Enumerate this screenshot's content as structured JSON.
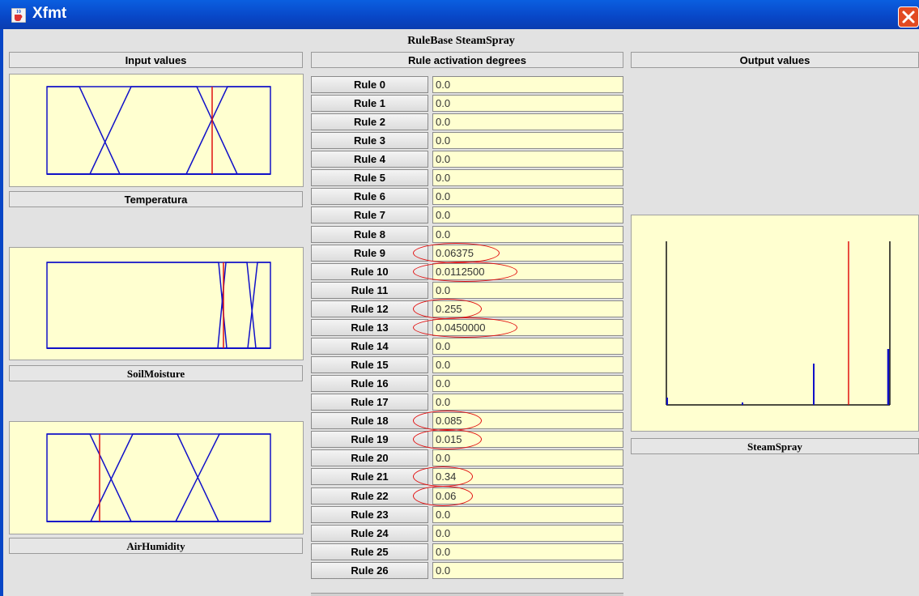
{
  "window": {
    "title": "Xfmt",
    "app_icon": "java-cup-icon",
    "close_icon": "close-x-icon"
  },
  "rulebase_title": "RuleBase SteamSpray",
  "panels": {
    "input_header": "Input values",
    "rules_header": "Rule activation degrees",
    "output_header": "Output values"
  },
  "inputs": [
    {
      "name": "Temperatura",
      "crisp_fraction": 0.74
    },
    {
      "name": "SoilMoisture",
      "crisp_fraction": 0.79
    },
    {
      "name": "AirHumidity",
      "crisp_fraction": 0.24
    }
  ],
  "output": {
    "name": "SteamSpray",
    "crisp_fraction": 0.81
  },
  "rules": [
    {
      "label": "Rule 0",
      "value": "0.0",
      "highlighted": false
    },
    {
      "label": "Rule 1",
      "value": "0.0",
      "highlighted": false
    },
    {
      "label": "Rule 2",
      "value": "0.0",
      "highlighted": false
    },
    {
      "label": "Rule 3",
      "value": "0.0",
      "highlighted": false
    },
    {
      "label": "Rule 4",
      "value": "0.0",
      "highlighted": false
    },
    {
      "label": "Rule 5",
      "value": "0.0",
      "highlighted": false
    },
    {
      "label": "Rule 6",
      "value": "0.0",
      "highlighted": false
    },
    {
      "label": "Rule 7",
      "value": "0.0",
      "highlighted": false
    },
    {
      "label": "Rule 8",
      "value": "0.0",
      "highlighted": false
    },
    {
      "label": "Rule 9",
      "value": "0.06375",
      "highlighted": true
    },
    {
      "label": "Rule 10",
      "value": "0.0112500",
      "highlighted": true
    },
    {
      "label": "Rule 11",
      "value": "0.0",
      "highlighted": false
    },
    {
      "label": "Rule 12",
      "value": "0.255",
      "highlighted": true
    },
    {
      "label": "Rule 13",
      "value": "0.0450000",
      "highlighted": true
    },
    {
      "label": "Rule 14",
      "value": "0.0",
      "highlighted": false
    },
    {
      "label": "Rule 15",
      "value": "0.0",
      "highlighted": false
    },
    {
      "label": "Rule 16",
      "value": "0.0",
      "highlighted": false
    },
    {
      "label": "Rule 17",
      "value": "0.0",
      "highlighted": false
    },
    {
      "label": "Rule 18",
      "value": "0.085",
      "highlighted": true
    },
    {
      "label": "Rule 19",
      "value": "0.015",
      "highlighted": true
    },
    {
      "label": "Rule 20",
      "value": "0.0",
      "highlighted": false
    },
    {
      "label": "Rule 21",
      "value": "0.34",
      "highlighted": true
    },
    {
      "label": "Rule 22",
      "value": "0.06",
      "highlighted": true
    },
    {
      "label": "Rule 23",
      "value": "0.0",
      "highlighted": false
    },
    {
      "label": "Rule 24",
      "value": "0.0",
      "highlighted": false
    },
    {
      "label": "Rule 25",
      "value": "0.0",
      "highlighted": false
    },
    {
      "label": "Rule 26",
      "value": "0.0",
      "highlighted": false
    }
  ],
  "colors": {
    "membership": "#1010c8",
    "crisp": "#e01010",
    "plot_bg": "#ffffd0",
    "title_bar": "#0846c6",
    "highlight": "#e21010"
  }
}
